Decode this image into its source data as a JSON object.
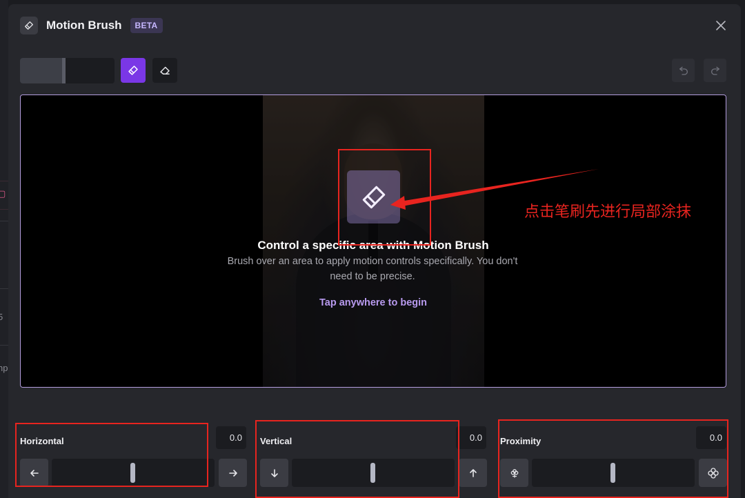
{
  "background": {
    "edge_text_1": "I",
    "edge_text_2": "5",
    "edge_text_3": "np"
  },
  "modal": {
    "title": "Motion Brush",
    "badge": "BETA"
  },
  "canvas": {
    "prompt_title": "Control a specific area with Motion Brush",
    "prompt_description": "Brush over an area to apply motion controls specifically. You don't need to be precise.",
    "prompt_cta": "Tap anywhere to begin"
  },
  "toolbar": {
    "brush_size_level": 0.47
  },
  "sliders": {
    "horizontal": {
      "label": "Horizontal",
      "value": "0.0"
    },
    "vertical": {
      "label": "Vertical",
      "value": "0.0"
    },
    "proximity": {
      "label": "Proximity",
      "value": "0.0"
    }
  },
  "annotation": {
    "text": "点击笔刷先进行局部涂抹",
    "color": "#e8241f"
  },
  "colors": {
    "accent": "#7a37e6",
    "canvas_border": "#b59ee0",
    "cta": "#b89aef"
  }
}
